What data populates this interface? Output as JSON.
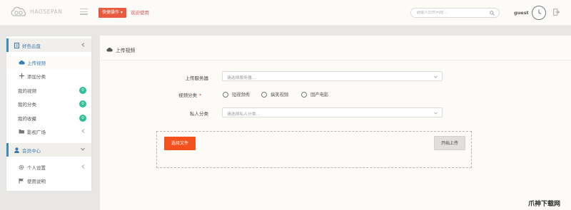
{
  "header": {
    "logo_text": "HAOSEPAN",
    "quick_action_label": "快捷操作 ▾",
    "welcome_text": "欢迎使用",
    "search": {
      "placeholder": "请输入您的问题..."
    },
    "user_name": "guest"
  },
  "sidebar": {
    "groups": [
      {
        "label": "好色云盘",
        "items": [
          {
            "label": "上传视频",
            "active": true
          },
          {
            "label": "添加分类"
          },
          {
            "label": "我的视频",
            "badge": "0"
          },
          {
            "label": "我的分类",
            "badge": "0"
          },
          {
            "label": "我的收藏",
            "badge": "0"
          },
          {
            "label": "影视广场"
          }
        ]
      },
      {
        "label": "会员中心",
        "items": [
          {
            "label": "个人设置"
          },
          {
            "label": "使用说明"
          }
        ]
      }
    ]
  },
  "main": {
    "title": "上传视频",
    "form": {
      "server": {
        "label": "上传服务器",
        "placeholder": "请选择服务器..."
      },
      "category": {
        "label": "视频分类",
        "required_mark": "*",
        "options": [
          "短视频秀",
          "搞笑视频",
          "国产电影"
        ]
      },
      "private_category": {
        "label": "私人分类",
        "placeholder": "请选择私人分类..."
      }
    },
    "upload": {
      "choose_label": "选择文件",
      "start_label": "开始上传"
    }
  },
  "watermark": "爪神下载网",
  "colors": {
    "accent": "#e8593d",
    "sidebar_group": "#3b8dbd",
    "badge": "#2fbf9b",
    "background": "#e9e7e5"
  }
}
